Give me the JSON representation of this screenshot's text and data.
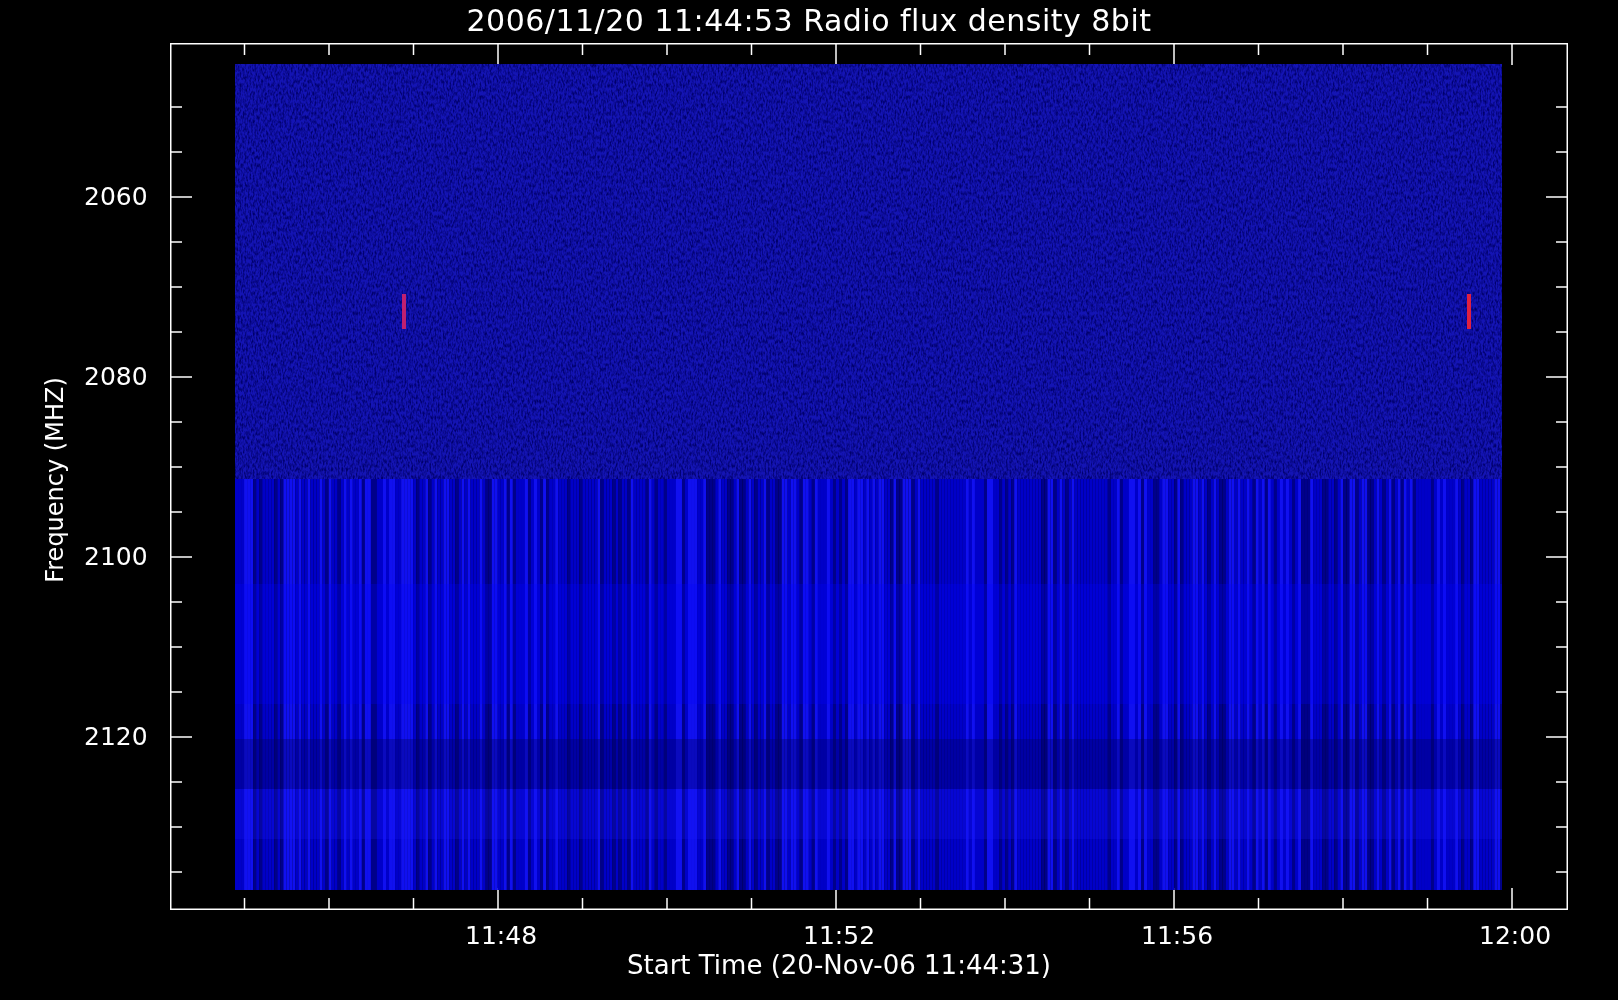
{
  "plot": {
    "title": "2006/11/20 11:44:53 Radio flux density 8bit",
    "ylabel": "Frequency (MHZ)",
    "xlabel": "Start Time (20-Nov-06 11:44:31)",
    "yticks": [
      "2060",
      "2080",
      "2100",
      "2120"
    ],
    "xticks": [
      "11:48",
      "11:52",
      "11:56",
      "12:00"
    ]
  }
}
